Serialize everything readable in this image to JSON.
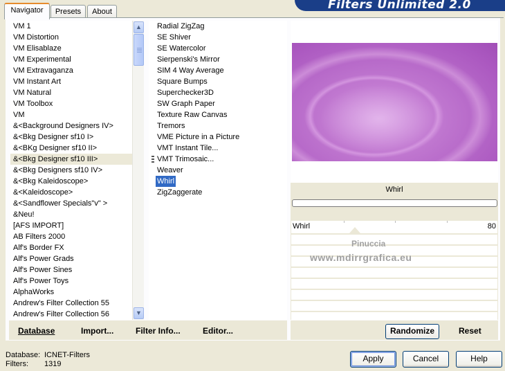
{
  "tabs": [
    {
      "label": "Navigator",
      "active": true
    },
    {
      "label": "Presets",
      "active": false
    },
    {
      "label": "About",
      "active": false
    }
  ],
  "banner": {
    "title": "Filters Unlimited 2.0"
  },
  "categories": {
    "items": [
      "VM 1",
      "VM Distortion",
      "VM Elisablaze",
      "VM Experimental",
      "VM Extravaganza",
      "VM Instant Art",
      "VM Natural",
      "VM Toolbox",
      "VM",
      "&<Background Designers IV>",
      "&<Bkg Designer sf10 I>",
      "&<BKg Designer sf10 II>",
      "&<Bkg Designer sf10 III>",
      "&<Bkg Designers sf10 IV>",
      "&<Bkg Kaleidoscope>",
      "&<Kaleidoscope>",
      "&<Sandflower Specials\"v\" >",
      "&Neu!",
      "[AFS IMPORT]",
      "AB Filters 2000",
      "Alf's Border FX",
      "Alf's Power Grads",
      "Alf's Power Sines",
      "Alf's Power Toys",
      "AlphaWorks",
      "Andrew's Filter Collection 55",
      "Andrew's Filter Collection 56"
    ],
    "highlighted": "&<Bkg Designer sf10 III>"
  },
  "filters": {
    "items": [
      "Radial ZigZag",
      "SE Shiver",
      "SE Watercolor",
      "Sierpenski's Mirror",
      "SIM 4 Way Average",
      "Square Bumps",
      "Superchecker3D",
      "SW Graph Paper",
      "Texture Raw Canvas",
      "Tremors",
      "VME Picture in a Picture",
      "VMT Instant Tile...",
      "VMT Trimosaic...",
      "Weaver",
      "Whirl",
      "ZigZaggerate"
    ],
    "selected": "Whirl"
  },
  "params": {
    "title": "Whirl",
    "rows": [
      {
        "name": "Whirl",
        "value": "80"
      }
    ]
  },
  "watermark": {
    "line1": "Pinuccia",
    "line2": "www.mdirrgrafica.eu"
  },
  "toolbar": {
    "database": "Database",
    "import": "Import...",
    "filter_info": "Filter Info...",
    "editor": "Editor...",
    "randomize": "Randomize",
    "reset": "Reset"
  },
  "status": {
    "database_label": "Database:",
    "database_value": "ICNET-Filters",
    "filters_label": "Filters:",
    "filters_value": "1319"
  },
  "buttons": {
    "apply": "Apply",
    "cancel": "Cancel",
    "help": "Help"
  },
  "colors": {
    "accent": "#316ac5",
    "banner": "#1a3e88",
    "preview": "#ab58c0"
  }
}
